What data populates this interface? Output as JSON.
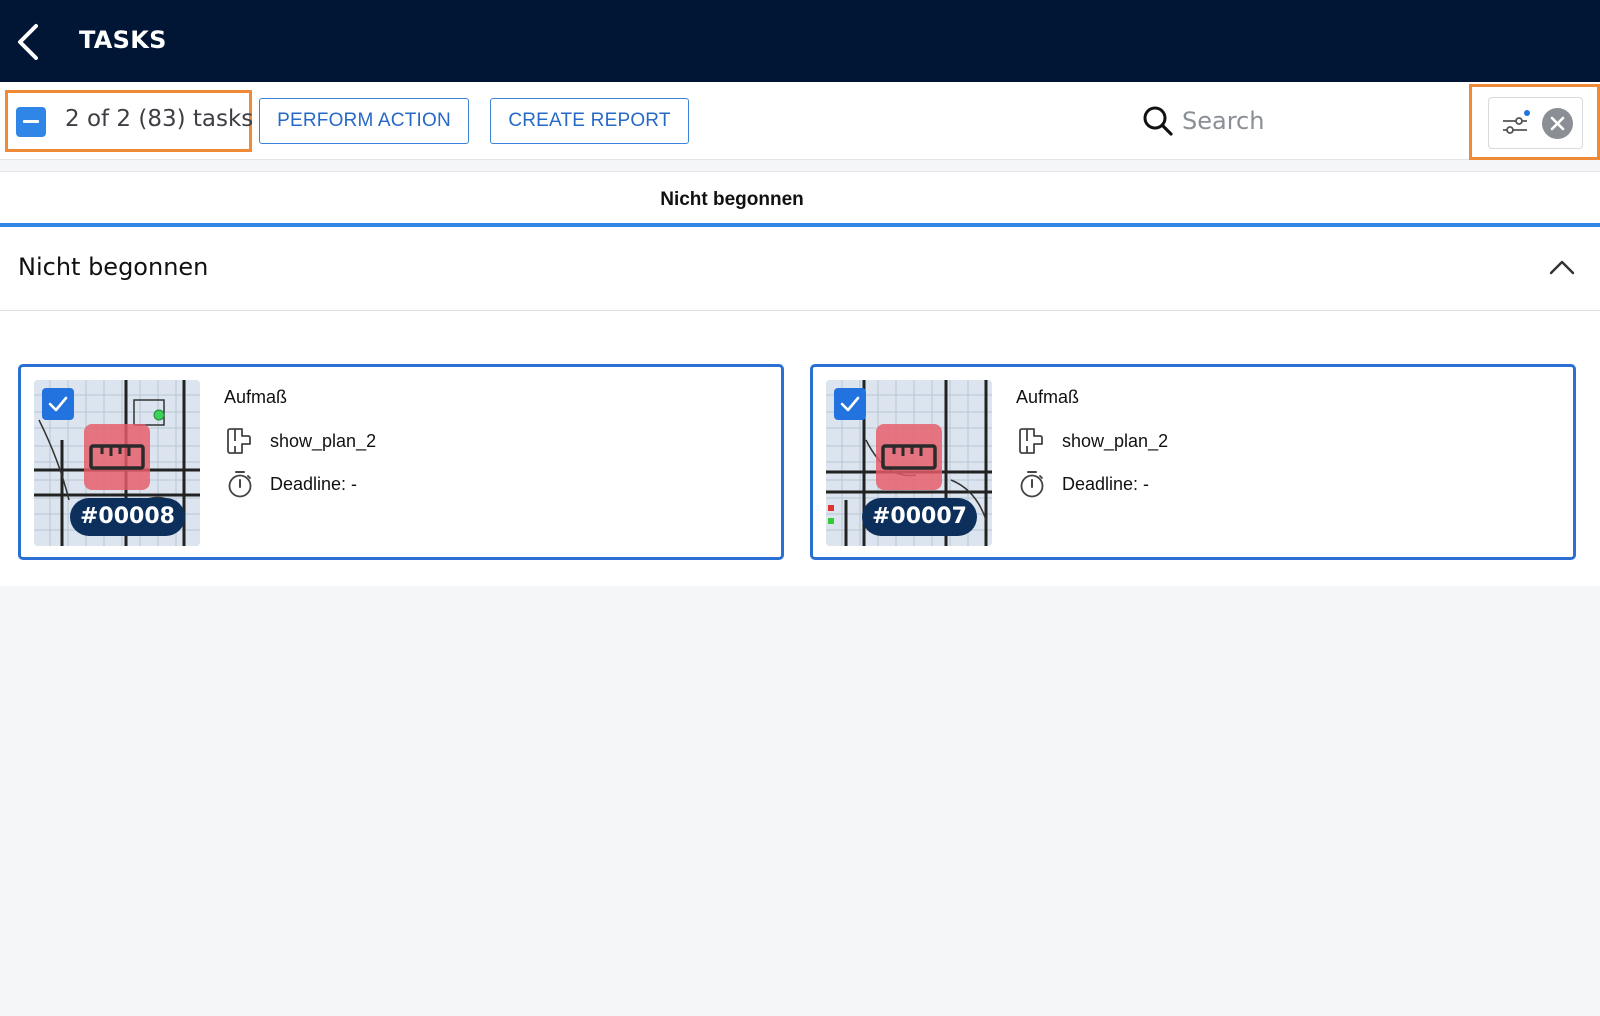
{
  "header": {
    "title": "TASKS",
    "back_icon": "chevron-left-icon"
  },
  "toolbar": {
    "selection_count": "2 of 2 (83) tasks",
    "perform_action_label": "PERFORM ACTION",
    "create_report_label": "CREATE REPORT",
    "search_placeholder": "Search",
    "search_value": "",
    "filter_icon": "sliders-icon",
    "clear_icon": "close-circle-icon"
  },
  "tabs": [
    {
      "label": "Nicht begonnen",
      "active": true
    }
  ],
  "section": {
    "title": "Nicht begonnen",
    "expanded": true
  },
  "cards": [
    {
      "id": "#00008",
      "type": "Aufmaß",
      "plan": "show_plan_2",
      "deadline": "Deadline: -",
      "selected": true
    },
    {
      "id": "#00007",
      "type": "Aufmaß",
      "plan": "show_plan_2",
      "deadline": "Deadline: -",
      "selected": true
    }
  ],
  "colors": {
    "header_bg": "#011634",
    "accent": "#2f86e6",
    "highlight": "#f08a37",
    "card_border": "#2a70d4",
    "measure_badge": "#e85c68",
    "id_pill": "#0d2f5c"
  }
}
